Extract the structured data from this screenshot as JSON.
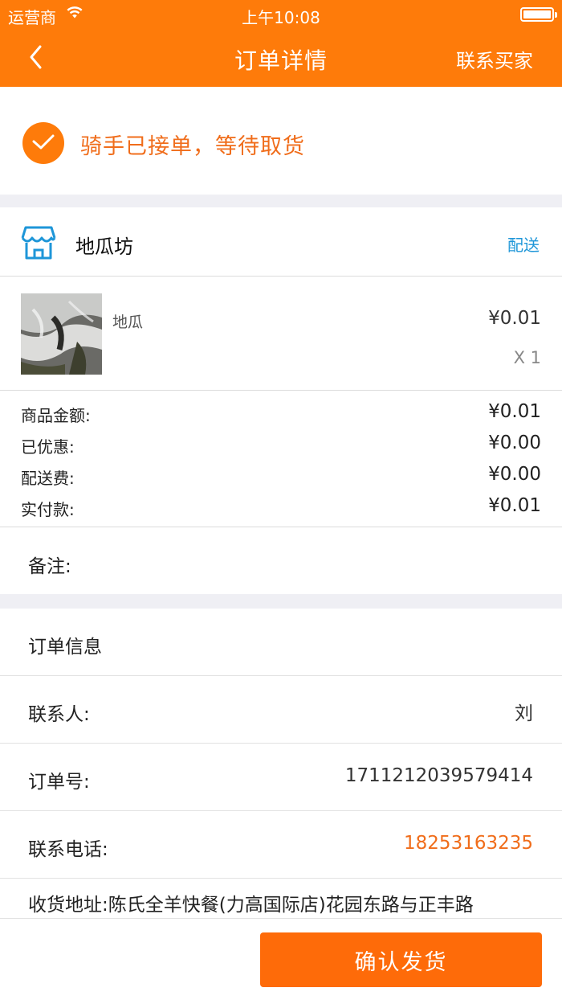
{
  "status_bar": {
    "carrier": "运营商",
    "time": "上午10:08"
  },
  "nav": {
    "title": "订单详情",
    "contact_buyer": "联系买家"
  },
  "order_status": {
    "text": "骑手已接单，等待取货"
  },
  "shop": {
    "name": "地瓜坊",
    "delivery_tag": "配送"
  },
  "product": {
    "name": "地瓜",
    "price": "¥0.01",
    "quantity": "X 1"
  },
  "summary": [
    {
      "label": "商品金额:",
      "value": "¥0.01"
    },
    {
      "label": "已优惠:",
      "value": "¥0.00"
    },
    {
      "label": "配送费:",
      "value": "¥0.00"
    },
    {
      "label": "实付款:",
      "value": "¥0.01"
    }
  ],
  "remark": {
    "label": "备注:"
  },
  "order_info": {
    "heading": "订单信息",
    "contact_label": "联系人:",
    "contact_value": "刘",
    "order_no_label": "订单号:",
    "order_no_value": "1711212039579414",
    "phone_label": "联系电话:",
    "phone_value": "18253163235",
    "address_label": "收货地址:",
    "address_value": "陈氏全羊快餐(力高国际店)花园东路与正丰路"
  },
  "actions": {
    "confirm_shipment": "确认发货"
  },
  "colors": {
    "accent": "#fe7b0a",
    "button": "#fe6b09",
    "link_blue": "#1e96d8",
    "status_text": "#f06d1b"
  },
  "icons": [
    "wifi-icon",
    "battery-icon",
    "back-chevron-icon",
    "check-circle-icon",
    "shop-icon"
  ]
}
